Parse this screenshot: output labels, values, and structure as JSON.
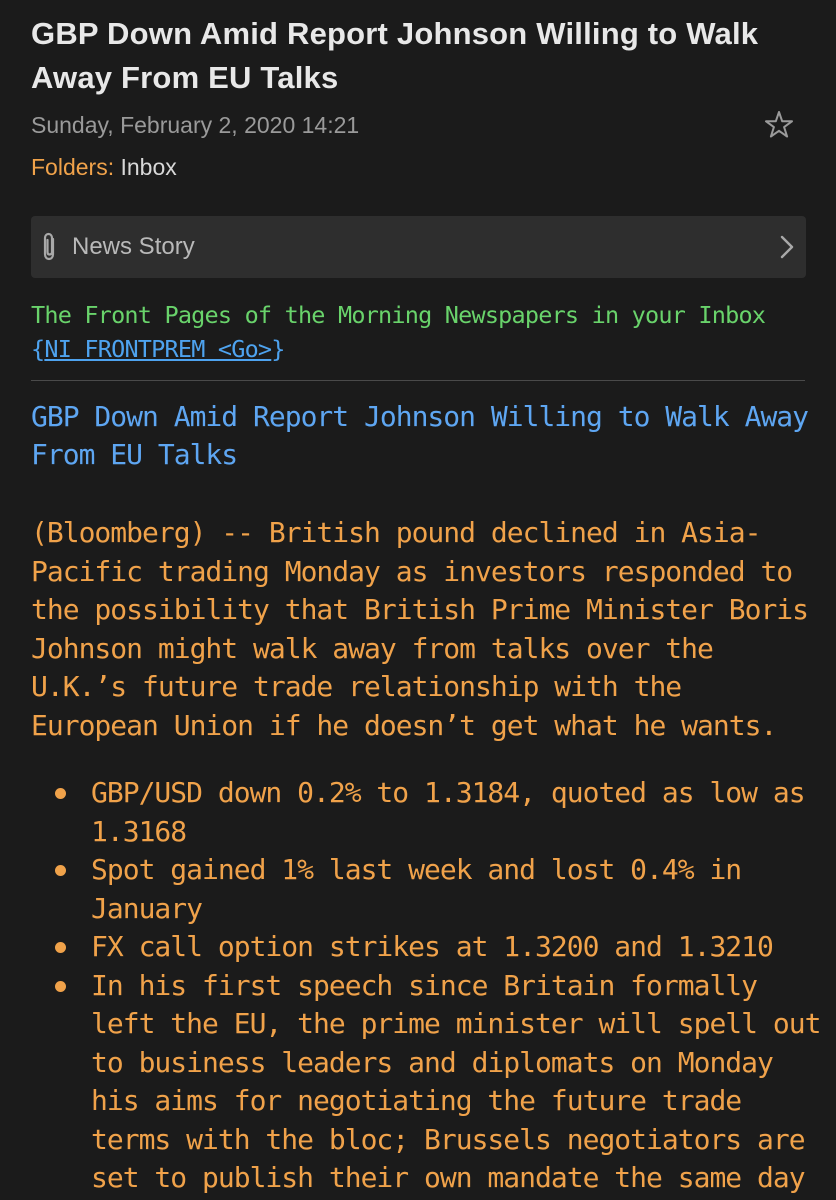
{
  "message": {
    "title": "GBP Down Amid Report Johnson Willing to Walk Away From EU Talks",
    "date": "Sunday, February 2, 2020 14:21",
    "folders_label": "Folders:",
    "folders_value": "Inbox",
    "star_icon": "star-outline-icon"
  },
  "attachment": {
    "label": "News Story",
    "clip_icon": "paperclip-icon",
    "chevron_icon": "chevron-right-icon"
  },
  "body": {
    "promo_text": "The Front Pages of the Morning Newspapers in your Inbox",
    "promo_brace_open": "{",
    "promo_link": "NI FRONTPREM <Go>",
    "promo_brace_close": "}",
    "headline": "GBP Down Amid Report Johnson Willing to Walk Away From EU Talks",
    "lead": "(Bloomberg) -- British pound declined in Asia-Pacific trading Monday as investors responded to the possibility that British Prime Minister Boris Johnson might walk away from talks over the U.K.’s future trade relationship with the European Union if he doesn’t get what he wants.",
    "bullets": [
      "GBP/USD down 0.2% to 1.3184, quoted as low as 1.3168",
      "Spot gained 1% last week and lost 0.4% in January",
      "FX call option strikes at 1.3200 and 1.3210",
      "In his first speech since Britain formally left the EU, the prime minister will spell out to business leaders and diplomats on Monday his aims for negotiating the future trade terms with the bloc; Brussels negotiators are set to publish their own mandate the same day"
    ]
  },
  "colors": {
    "background": "#1b1b1b",
    "title": "#e8e8e8",
    "meta": "#9a9a9a",
    "accent_orange": "#f0a24a",
    "link_blue": "#4ea3ef",
    "headline_blue": "#5ea6f2",
    "promo_green": "#69d36b",
    "attachment_bg": "#2e2e2e"
  }
}
